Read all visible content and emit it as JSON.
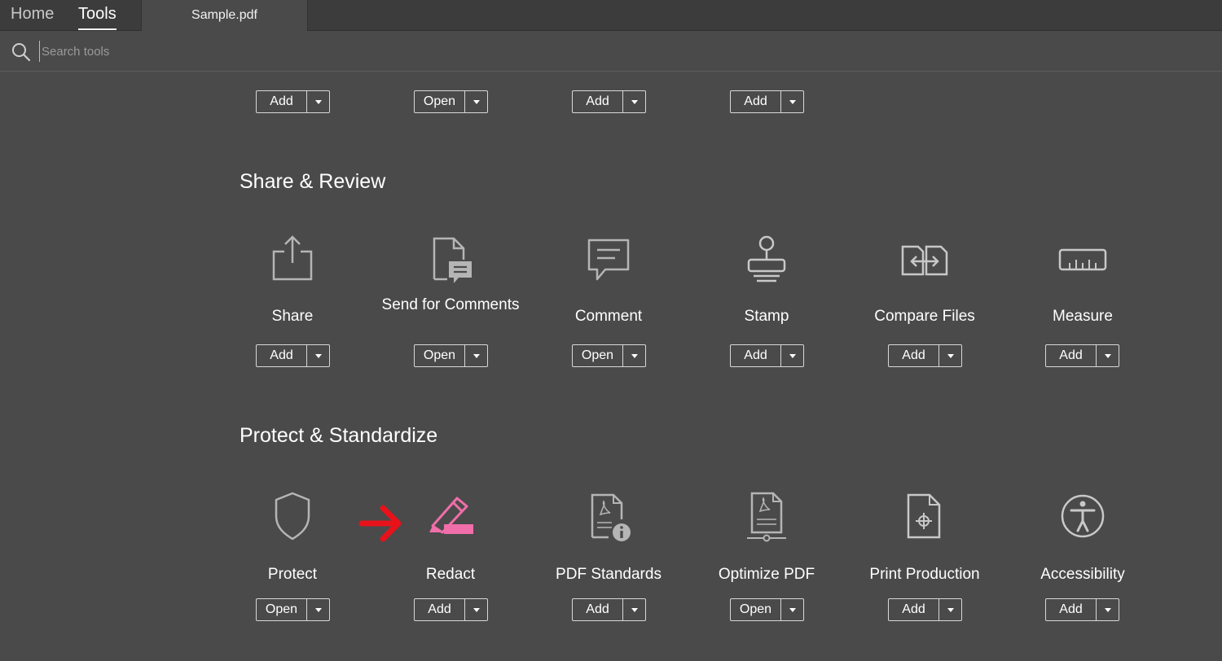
{
  "nav": {
    "home": "Home",
    "tools": "Tools",
    "doc_tab": "Sample.pdf"
  },
  "search": {
    "placeholder": "Search tools"
  },
  "top_row": [
    {
      "button": "Add"
    },
    {
      "button": "Open"
    },
    {
      "button": "Add"
    },
    {
      "button": "Add"
    }
  ],
  "sections": [
    {
      "title": "Share & Review",
      "tools": [
        {
          "label": "Share",
          "button": "Add",
          "icon": "share-icon"
        },
        {
          "label": "Send for Comments",
          "button": "Open",
          "icon": "send-for-comments-icon"
        },
        {
          "label": "Comment",
          "button": "Open",
          "icon": "comment-icon"
        },
        {
          "label": "Stamp",
          "button": "Add",
          "icon": "stamp-icon"
        },
        {
          "label": "Compare Files",
          "button": "Add",
          "icon": "compare-files-icon"
        },
        {
          "label": "Measure",
          "button": "Add",
          "icon": "ruler-icon"
        }
      ]
    },
    {
      "title": "Protect & Standardize",
      "tools": [
        {
          "label": "Protect",
          "button": "Open",
          "icon": "shield-icon"
        },
        {
          "label": "Redact",
          "button": "Add",
          "icon": "redact-marker-icon"
        },
        {
          "label": "PDF Standards",
          "button": "Add",
          "icon": "pdf-standards-icon"
        },
        {
          "label": "Optimize PDF",
          "button": "Open",
          "icon": "optimize-pdf-icon"
        },
        {
          "label": "Print Production",
          "button": "Add",
          "icon": "print-production-icon"
        },
        {
          "label": "Accessibility",
          "button": "Add",
          "icon": "accessibility-icon"
        }
      ]
    }
  ],
  "colors": {
    "accent_redact": "#f06eaa",
    "annotation_arrow": "#e8121b",
    "icon_gray": "#b5b5b5"
  }
}
